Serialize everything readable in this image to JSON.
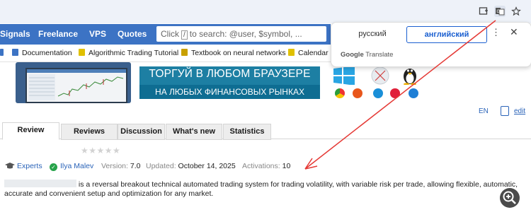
{
  "colors": {
    "site_nav": "#3c73c4",
    "banner": "#1d7fa3",
    "link": "#2a63b8",
    "annotation_arrow": "#e53935"
  },
  "browser": {
    "icons": [
      "download-icon",
      "translate-icon",
      "star-bookmark-icon"
    ]
  },
  "nav": {
    "items": [
      "Signals",
      "Freelance",
      "VPS",
      "Quotes"
    ],
    "search_key": "/",
    "search_placeholder_prefix": "Click",
    "search_placeholder_suffix": "to search: @user, $symbol, ..."
  },
  "bookmarks": [
    "Documentation",
    "Algorithmic Trading Tutorial",
    "Textbook on neural networks",
    "Calendar"
  ],
  "translate": {
    "source": "русский",
    "target": "английский",
    "brand_google": "Google",
    "brand_translate": "Translate",
    "menu": "⋮",
    "close": "✕"
  },
  "banner": {
    "line1": "ТОРГУЙ В ЛЮБОМ БРАУЗЕРЕ",
    "line2": "НА ЛЮБЫХ ФИНАНСОВЫХ РЫНКАХ"
  },
  "lang": {
    "code": "EN",
    "edit": "edit"
  },
  "tabs": [
    "Review",
    "Reviews",
    "Discussion",
    "What's new",
    "Statistics"
  ],
  "rating": {
    "stars": "★★★★★",
    "value": 0
  },
  "product": {
    "category": "Experts",
    "author": "Ilya Malev",
    "version_label": "Version:",
    "version": "7.0",
    "updated_label": "Updated:",
    "updated": "October 14, 2025",
    "activations_label": "Activations:",
    "activations": "10"
  },
  "description": {
    "line1": " is a reversal breakout technical automated trading system for trading volatility, with variable risk per trade, allowing flexible, automatic,",
    "line2": "accurate and convenient setup and optimization for any market."
  },
  "zoom_icon": "zoom-in-icon"
}
